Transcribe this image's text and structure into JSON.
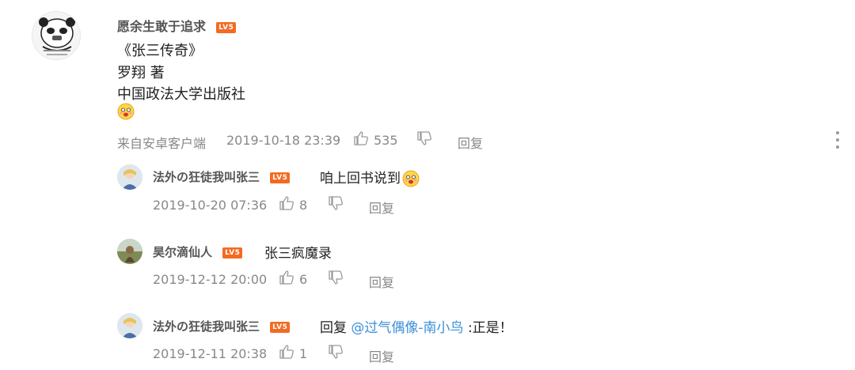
{
  "main_comment": {
    "username": "愿余生敢于追求",
    "level": "LV5",
    "lines": [
      "《张三传奇》",
      "罗翔 著",
      "中国政法大学出版社"
    ],
    "source": "来自安卓客户端",
    "time": "2019-10-18 23:39",
    "likes": "535",
    "reply_label": "回复"
  },
  "replies": [
    {
      "username": "法外の狂徒我叫张三",
      "level": "LV5",
      "text": "咱上回书说到",
      "time": "2019-10-20 07:36",
      "likes": "8",
      "reply_label": "回复"
    },
    {
      "username": "昊尔滴仙人",
      "level": "LV5",
      "text": "张三疯魔录",
      "time": "2019-12-12 20:00",
      "likes": "6",
      "reply_label": "回复"
    },
    {
      "username": "法外の狂徒我叫张三",
      "level": "LV5",
      "text_prefix": "回复",
      "mention": "@过气偶像-南小鸟",
      "text_suffix": ":正是！",
      "time": "2019-12-11 20:38",
      "likes": "1",
      "reply_label": "回复"
    }
  ],
  "icons": {
    "like": "thumbs-up-icon",
    "dislike": "thumbs-down-icon",
    "more": "more-vertical-icon",
    "emoji": "emoji-face-icon"
  },
  "colors": {
    "level_badge": "#f36b21",
    "mention": "#3a8fd9",
    "meta_text": "#888888"
  }
}
